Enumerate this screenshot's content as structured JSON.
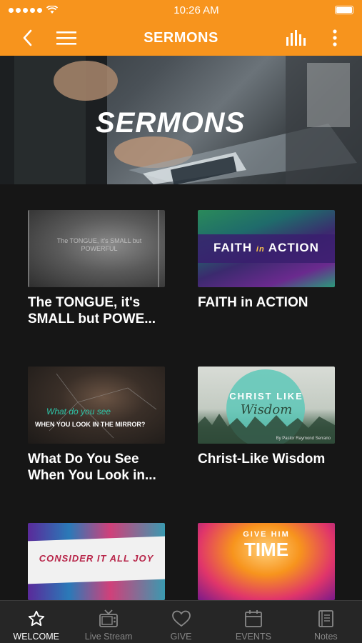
{
  "status": {
    "time": "10:26 AM"
  },
  "nav": {
    "title": "SERMONS"
  },
  "hero": {
    "label": "SERMONS"
  },
  "sermons": [
    {
      "title": "The TONGUE, it's SMALL but POWE...",
      "thumb_text": "The TONGUE, it's SMALL but POWERFUL"
    },
    {
      "title": "FAITH in ACTION",
      "thumb_text_1": "FAITH",
      "thumb_text_2": "in",
      "thumb_text_3": "ACTION"
    },
    {
      "title": "What Do You See When You Look in...",
      "thumb_text_1": "What do you see",
      "thumb_text_2": "WHEN YOU LOOK IN THE MIRROR?"
    },
    {
      "title": "Christ-Like Wisdom",
      "thumb_text_1": "CHRIST LIKE",
      "thumb_text_2": "Wisdom",
      "thumb_text_3": "By Pastor Raymond Serrano"
    },
    {
      "title": "",
      "thumb_text": "CONSIDER IT ALL JOY"
    },
    {
      "title": "",
      "thumb_text_1": "GIVE HIM",
      "thumb_text_2": "TIME"
    }
  ],
  "tabs": [
    {
      "label": "WELCOME",
      "icon": "star-icon",
      "active": true
    },
    {
      "label": "Live Stream",
      "icon": "tv-icon",
      "active": false
    },
    {
      "label": "GIVE",
      "icon": "heart-icon",
      "active": false
    },
    {
      "label": "EVENTS",
      "icon": "calendar-icon",
      "active": false
    },
    {
      "label": "Notes",
      "icon": "notes-icon",
      "active": false
    }
  ],
  "colors": {
    "accent": "#f7941d",
    "background": "#161616",
    "tabbar": "#262626"
  }
}
